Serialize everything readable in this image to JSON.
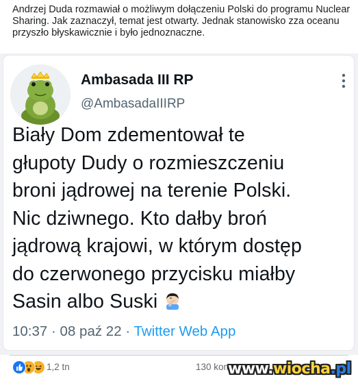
{
  "post": {
    "text": "Andrzej Duda rozmawiał o możliwym dołączeniu Polski do programu Nuclear Sharing. Jak zaznaczył, temat jest otwarty. Jednak stanowisko zza oceanu przyszło błyskawicznie i było jednoznaczne."
  },
  "tweet": {
    "author_name": "Ambasada III RP",
    "author_handle": "@AmbasadaIIIRP",
    "avatar_icon": "frog-plush-avatar-icon",
    "more_icon": "vertical-dots-icon",
    "lines": [
      "Biały Dom zdementował te",
      "głupoty Dudy o rozmieszczeniu",
      "broni jądrowej na terenie Polski.",
      "Nic dziwnego. Kto dałby broń",
      "jądrową krajowi, w którym dostęp",
      "do czerwonego przycisku miałby",
      "Sasin albo Suski"
    ],
    "emoji": "facepalm-emoji",
    "time": "10:37",
    "date": "08 paź 22",
    "source": "Twitter Web App",
    "separator": "·"
  },
  "reactions": {
    "icons": [
      "like-icon",
      "wow-icon",
      "haha-icon"
    ],
    "colors": {
      "like": "#1877f2",
      "wow": "#f7b125",
      "haha": "#f7b125"
    },
    "count": "1,2 tn",
    "comments": "130 kom"
  },
  "watermark": {
    "prefix": "www.",
    "brand": "wiocha",
    "suffix": ".pl"
  }
}
